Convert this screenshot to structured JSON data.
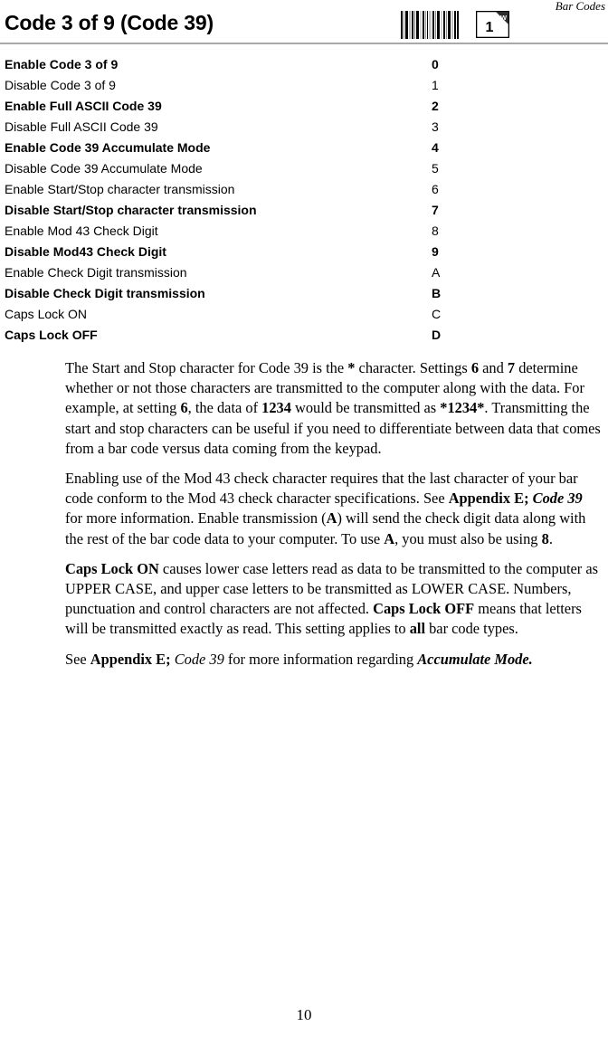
{
  "header": {
    "title": "Code 3 of 9 (Code 39)",
    "section_label": "Bar Codes",
    "barcode_icon_name": "barcode-icon",
    "page_corner_icon_name": "page-corner-icon",
    "page_corner_number": "1",
    "page_corner_mark": "W"
  },
  "settings_table": {
    "rows": [
      {
        "label": "Enable Code 3 of 9",
        "code": "0",
        "bold": true
      },
      {
        "label": "Disable Code 3 of 9",
        "code": "1",
        "bold": false
      },
      {
        "label": "Enable Full ASCII Code 39",
        "code": "2",
        "bold": true
      },
      {
        "label": "Disable Full ASCII Code 39",
        "code": "3",
        "bold": false
      },
      {
        "label": "Enable Code 39 Accumulate Mode",
        "code": "4",
        "bold": true
      },
      {
        "label": "Disable Code 39 Accumulate Mode",
        "code": "5",
        "bold": false
      },
      {
        "label": "Enable Start/Stop character transmission",
        "code": "6",
        "bold": false
      },
      {
        "label": "Disable Start/Stop character transmission",
        "code": "7",
        "bold": true
      },
      {
        "label": "Enable Mod 43 Check Digit",
        "code": "8",
        "bold": false
      },
      {
        "label": "Disable Mod43 Check Digit",
        "code": "9",
        "bold": true
      },
      {
        "label": "Enable Check Digit transmission",
        "code": "A",
        "bold": false
      },
      {
        "label": "Disable Check Digit transmission",
        "code": "B",
        "bold": true
      },
      {
        "label": "Caps Lock ON",
        "code": "C",
        "bold": false
      },
      {
        "label": "Caps Lock OFF",
        "code": "D",
        "bold": true
      }
    ]
  },
  "paragraphs": {
    "p1": {
      "s1": "The Start and Stop character for Code 39 is the ",
      "b1": "*",
      "s2": " character.  Settings ",
      "b2": "6",
      "s3": " and ",
      "b3": "7",
      "s4": " determine whether or not those characters are transmitted to the computer along with the data.  For example, at setting ",
      "b4": "6",
      "s5": ", the data of ",
      "b5": "1234",
      "s6": " would be transmitted as ",
      "b6": "*1234*",
      "s7": ".  Transmitting the start and stop characters can be useful if you need to differentiate between data that comes from a bar code versus data coming from the keypad."
    },
    "p2": {
      "s1": "Enabling use of the Mod 43 check character requires that the last character of your bar code conform to the Mod 43 check character specifications.  See ",
      "b1": "Appendix E;",
      "s2": " ",
      "bi1": "Code 39",
      "s3": " for more information.   Enable transmission (",
      "b2": "A",
      "s4": ") will send the check digit data along with the rest of the bar code data to your computer.  To use ",
      "b3": "A",
      "s5": ", you must also be using ",
      "b4": "8",
      "s6": "."
    },
    "p3": {
      "b1": "Caps Lock ON",
      "s1": " causes lower case letters read as data to be transmitted to the computer as UPPER CASE, and upper case letters to be transmitted as LOWER CASE.  Numbers, punctuation and control characters are not affected.  ",
      "b2": "Caps Lock OFF",
      "s2": " means that letters will be transmitted exactly as read. This setting applies to ",
      "b3": "all",
      "s3": " bar code types."
    },
    "p4": {
      "s1": "See ",
      "b1": "Appendix E;",
      "s2": " ",
      "i1": "Code 39",
      "s3": " for more information regarding ",
      "bi1": "Accumulate Mode."
    }
  },
  "footer": {
    "page_number": "10"
  }
}
